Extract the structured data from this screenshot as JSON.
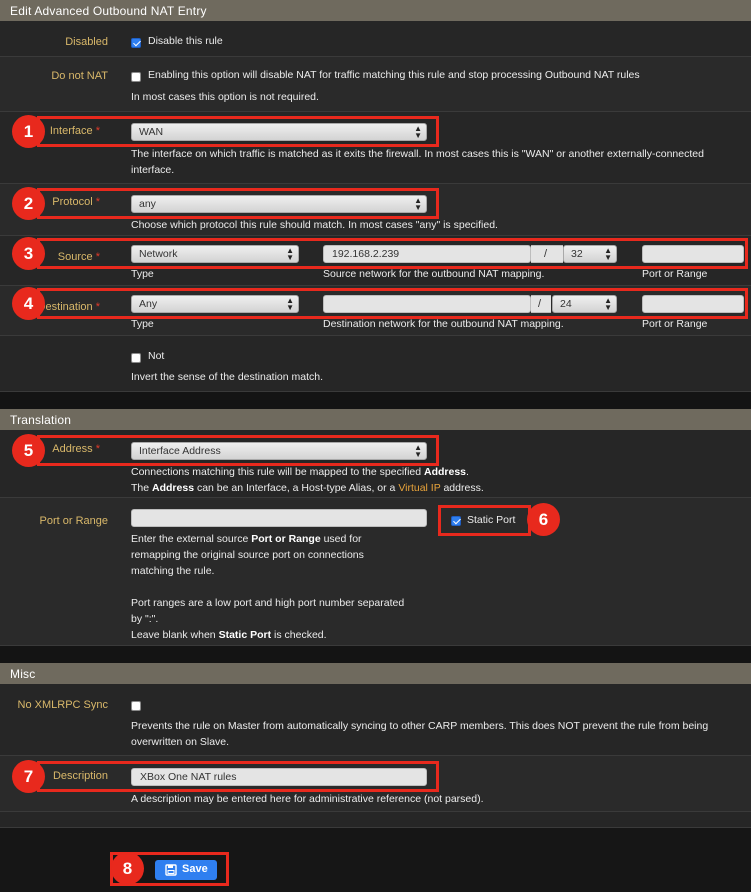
{
  "panels": {
    "main_title": "Edit Advanced Outbound NAT Entry",
    "translation_title": "Translation",
    "misc_title": "Misc"
  },
  "disabled": {
    "label": "Disabled",
    "checkbox_label": "Disable this rule",
    "checked": true
  },
  "do_not_nat": {
    "label": "Do not NAT",
    "checkbox_label": "Enabling this option will disable NAT for traffic matching this rule and stop processing Outbound NAT rules",
    "help": "In most cases this option is not required.",
    "checked": false
  },
  "interface": {
    "label": "Interface",
    "required_mark": "*",
    "value": "WAN",
    "help_line1": "The interface on which traffic is matched as it exits the firewall. In most cases this is \"WAN\" or another externally-connected",
    "help_line2": "interface."
  },
  "protocol": {
    "label": "Protocol",
    "required_mark": "*",
    "value": "any",
    "help": "Choose which protocol this rule should match. In most cases \"any\" is specified."
  },
  "source": {
    "label": "Source",
    "required_mark": "*",
    "type_value": "Network",
    "network_value": "192.168.2.239",
    "slash": "/",
    "mask_value": "32",
    "port_value": "",
    "type_caption": "Type",
    "network_caption": "Source network for the outbound NAT mapping.",
    "port_caption": "Port or Range"
  },
  "destination": {
    "label": "Destination",
    "required_mark": "*",
    "type_value": "Any",
    "network_value": "",
    "slash": "/",
    "mask_value": "24",
    "port_value": "",
    "type_caption": "Type",
    "network_caption": "Destination network for the outbound NAT mapping.",
    "port_caption": "Port or Range"
  },
  "not": {
    "checkbox_label": "Not",
    "help": "Invert the sense of the destination match.",
    "checked": false
  },
  "address": {
    "label": "Address",
    "required_mark": "*",
    "value": "Interface Address",
    "help1_prefix": "Connections matching this rule will be mapped to the specified ",
    "help1_bold": "Address",
    "help1_suffix": ".",
    "help2_prefix": "The ",
    "help2_bold": "Address",
    "help2_mid": " can be an Interface, a Host-type Alias, or a ",
    "help2_link": "Virtual IP",
    "help2_suffix": " address."
  },
  "port_range": {
    "label": "Port or Range",
    "value": "",
    "help1_prefix": "Enter the external source ",
    "help1_bold": "Port or Range",
    "help1_suffix": " used for",
    "help2": "remapping the original source port on connections",
    "help3": "matching the rule.",
    "help4": "Port ranges are a low port and high port number separated",
    "help5": "by \":\".",
    "help6_prefix": "Leave blank when ",
    "help6_bold": "Static Port",
    "help6_suffix": " is checked."
  },
  "static_port": {
    "checkbox_label": "Static Port",
    "checked": true
  },
  "xmlrpc": {
    "label": "No XMLRPC Sync",
    "help_line1": "Prevents the rule on Master from automatically syncing to other CARP members. This does NOT prevent the rule from being",
    "help_line2": "overwritten on Slave.",
    "checked": false
  },
  "description": {
    "label": "Description",
    "value": "XBox One NAT rules",
    "help": "A description may be entered here for administrative reference (not parsed)."
  },
  "save_button": {
    "label": "Save",
    "icon": "save-icon"
  },
  "callouts": [
    "1",
    "2",
    "3",
    "4",
    "5",
    "6",
    "7",
    "8"
  ],
  "colors": {
    "accent_label": "#d9b86a",
    "callout_red": "#e8291d",
    "save_blue": "#2f7ff0",
    "link_orange": "#e8a33a",
    "panel_header": "#6f6a5e"
  }
}
